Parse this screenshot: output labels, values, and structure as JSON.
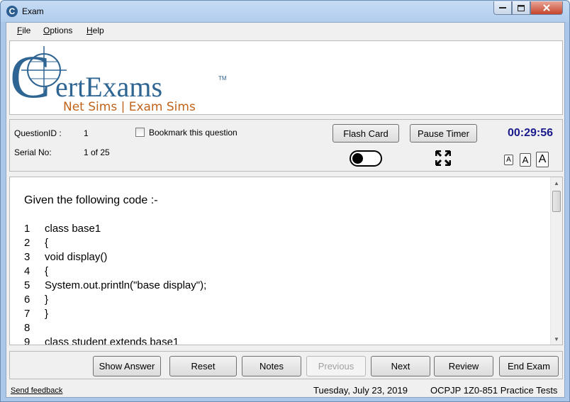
{
  "window": {
    "title": "Exam",
    "app_icon": "C"
  },
  "menu": [
    {
      "label": "File",
      "accel": "F",
      "rest": "ile"
    },
    {
      "label": "Options",
      "accel": "O",
      "rest": "ptions"
    },
    {
      "label": "Help",
      "accel": "H",
      "rest": "elp"
    }
  ],
  "logo": {
    "brand_initial": "C",
    "brand_rest": "ertExams",
    "trademark": "TM",
    "tagline": "Net Sims | Exam Sims",
    "colors": {
      "brand": "#2f6592",
      "tagline": "#c0631b"
    }
  },
  "info": {
    "question_id_label": "QuestionID :",
    "question_id_value": "1",
    "serial_label": "Serial No:",
    "serial_value": "1 of 25",
    "bookmark_label": "Bookmark this question",
    "flash_card": "Flash Card",
    "pause_timer": "Pause Timer",
    "timer": "00:29:56",
    "font_sizes": [
      "A",
      "A",
      "A"
    ],
    "icons": [
      "toggle-switch-icon",
      "expand-fullscreen-icon"
    ]
  },
  "question": {
    "intro": "Given the following code  :-",
    "lines": [
      {
        "num": "1",
        "code": "class base1"
      },
      {
        "num": "2",
        "code": "{"
      },
      {
        "num": "3",
        "code": "void display()"
      },
      {
        "num": "4",
        "code": "{"
      },
      {
        "num": "5",
        "code": "System.out.println(\"base display\");"
      },
      {
        "num": "6",
        "code": "}"
      },
      {
        "num": "7",
        "code": "}"
      },
      {
        "num": "8",
        "code": ""
      },
      {
        "num": "9",
        "code": "class student extends base1"
      }
    ]
  },
  "nav": {
    "show_answer": "Show Answer",
    "reset": "Reset",
    "notes": "Notes",
    "previous": "Previous",
    "next": "Next",
    "review": "Review",
    "end_exam": "End Exam"
  },
  "status": {
    "feedback": "Send feedback",
    "date": "Tuesday, July 23, 2019",
    "product": "OCPJP 1Z0-851 Practice Tests"
  }
}
